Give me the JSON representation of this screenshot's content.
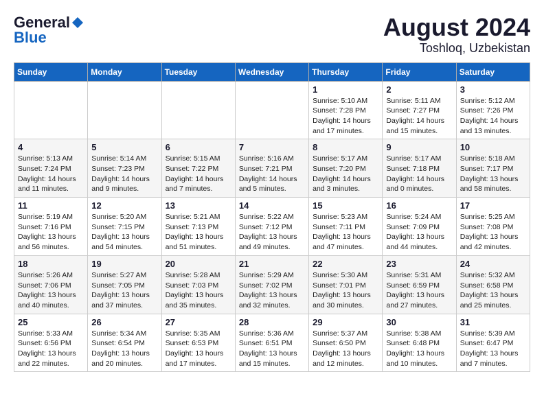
{
  "header": {
    "logo_general": "General",
    "logo_blue": "Blue",
    "month_year": "August 2024",
    "location": "Toshloq, Uzbekistan"
  },
  "weekdays": [
    "Sunday",
    "Monday",
    "Tuesday",
    "Wednesday",
    "Thursday",
    "Friday",
    "Saturday"
  ],
  "weeks": [
    [
      {
        "day": "",
        "info": ""
      },
      {
        "day": "",
        "info": ""
      },
      {
        "day": "",
        "info": ""
      },
      {
        "day": "",
        "info": ""
      },
      {
        "day": "1",
        "info": "Sunrise: 5:10 AM\nSunset: 7:28 PM\nDaylight: 14 hours\nand 17 minutes."
      },
      {
        "day": "2",
        "info": "Sunrise: 5:11 AM\nSunset: 7:27 PM\nDaylight: 14 hours\nand 15 minutes."
      },
      {
        "day": "3",
        "info": "Sunrise: 5:12 AM\nSunset: 7:26 PM\nDaylight: 14 hours\nand 13 minutes."
      }
    ],
    [
      {
        "day": "4",
        "info": "Sunrise: 5:13 AM\nSunset: 7:24 PM\nDaylight: 14 hours\nand 11 minutes."
      },
      {
        "day": "5",
        "info": "Sunrise: 5:14 AM\nSunset: 7:23 PM\nDaylight: 14 hours\nand 9 minutes."
      },
      {
        "day": "6",
        "info": "Sunrise: 5:15 AM\nSunset: 7:22 PM\nDaylight: 14 hours\nand 7 minutes."
      },
      {
        "day": "7",
        "info": "Sunrise: 5:16 AM\nSunset: 7:21 PM\nDaylight: 14 hours\nand 5 minutes."
      },
      {
        "day": "8",
        "info": "Sunrise: 5:17 AM\nSunset: 7:20 PM\nDaylight: 14 hours\nand 3 minutes."
      },
      {
        "day": "9",
        "info": "Sunrise: 5:17 AM\nSunset: 7:18 PM\nDaylight: 14 hours\nand 0 minutes."
      },
      {
        "day": "10",
        "info": "Sunrise: 5:18 AM\nSunset: 7:17 PM\nDaylight: 13 hours\nand 58 minutes."
      }
    ],
    [
      {
        "day": "11",
        "info": "Sunrise: 5:19 AM\nSunset: 7:16 PM\nDaylight: 13 hours\nand 56 minutes."
      },
      {
        "day": "12",
        "info": "Sunrise: 5:20 AM\nSunset: 7:15 PM\nDaylight: 13 hours\nand 54 minutes."
      },
      {
        "day": "13",
        "info": "Sunrise: 5:21 AM\nSunset: 7:13 PM\nDaylight: 13 hours\nand 51 minutes."
      },
      {
        "day": "14",
        "info": "Sunrise: 5:22 AM\nSunset: 7:12 PM\nDaylight: 13 hours\nand 49 minutes."
      },
      {
        "day": "15",
        "info": "Sunrise: 5:23 AM\nSunset: 7:11 PM\nDaylight: 13 hours\nand 47 minutes."
      },
      {
        "day": "16",
        "info": "Sunrise: 5:24 AM\nSunset: 7:09 PM\nDaylight: 13 hours\nand 44 minutes."
      },
      {
        "day": "17",
        "info": "Sunrise: 5:25 AM\nSunset: 7:08 PM\nDaylight: 13 hours\nand 42 minutes."
      }
    ],
    [
      {
        "day": "18",
        "info": "Sunrise: 5:26 AM\nSunset: 7:06 PM\nDaylight: 13 hours\nand 40 minutes."
      },
      {
        "day": "19",
        "info": "Sunrise: 5:27 AM\nSunset: 7:05 PM\nDaylight: 13 hours\nand 37 minutes."
      },
      {
        "day": "20",
        "info": "Sunrise: 5:28 AM\nSunset: 7:03 PM\nDaylight: 13 hours\nand 35 minutes."
      },
      {
        "day": "21",
        "info": "Sunrise: 5:29 AM\nSunset: 7:02 PM\nDaylight: 13 hours\nand 32 minutes."
      },
      {
        "day": "22",
        "info": "Sunrise: 5:30 AM\nSunset: 7:01 PM\nDaylight: 13 hours\nand 30 minutes."
      },
      {
        "day": "23",
        "info": "Sunrise: 5:31 AM\nSunset: 6:59 PM\nDaylight: 13 hours\nand 27 minutes."
      },
      {
        "day": "24",
        "info": "Sunrise: 5:32 AM\nSunset: 6:58 PM\nDaylight: 13 hours\nand 25 minutes."
      }
    ],
    [
      {
        "day": "25",
        "info": "Sunrise: 5:33 AM\nSunset: 6:56 PM\nDaylight: 13 hours\nand 22 minutes."
      },
      {
        "day": "26",
        "info": "Sunrise: 5:34 AM\nSunset: 6:54 PM\nDaylight: 13 hours\nand 20 minutes."
      },
      {
        "day": "27",
        "info": "Sunrise: 5:35 AM\nSunset: 6:53 PM\nDaylight: 13 hours\nand 17 minutes."
      },
      {
        "day": "28",
        "info": "Sunrise: 5:36 AM\nSunset: 6:51 PM\nDaylight: 13 hours\nand 15 minutes."
      },
      {
        "day": "29",
        "info": "Sunrise: 5:37 AM\nSunset: 6:50 PM\nDaylight: 13 hours\nand 12 minutes."
      },
      {
        "day": "30",
        "info": "Sunrise: 5:38 AM\nSunset: 6:48 PM\nDaylight: 13 hours\nand 10 minutes."
      },
      {
        "day": "31",
        "info": "Sunrise: 5:39 AM\nSunset: 6:47 PM\nDaylight: 13 hours\nand 7 minutes."
      }
    ]
  ]
}
